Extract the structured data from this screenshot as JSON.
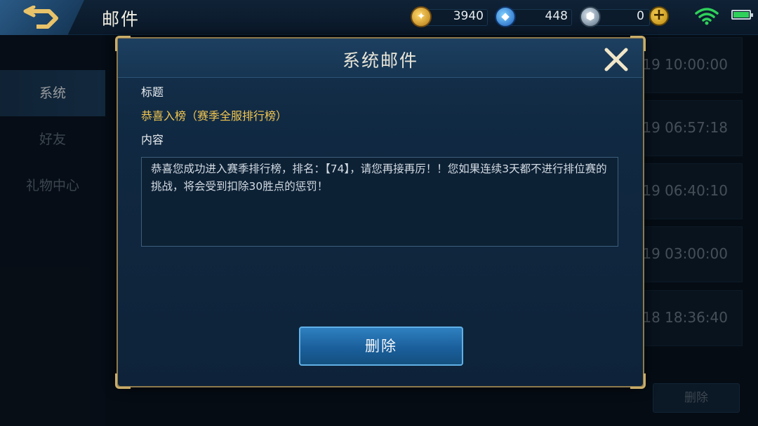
{
  "header": {
    "title": "邮件"
  },
  "currencies": [
    {
      "icon": "gold-coin-icon",
      "value": "3940"
    },
    {
      "icon": "diamond-icon",
      "value": "448"
    },
    {
      "icon": "voucher-icon",
      "value": "0"
    }
  ],
  "nav": {
    "items": [
      {
        "label": "系统"
      },
      {
        "label": "好友"
      },
      {
        "label": "礼物中心"
      }
    ]
  },
  "mail_list": {
    "times": [
      "-19 10:00:00",
      "-19 06:57:18",
      "-19 06:40:10",
      "-19 03:00:00",
      "-18 18:36:40"
    ],
    "delete_label": "删除"
  },
  "modal": {
    "title": "系统邮件",
    "subject_label": "标题",
    "subject": "恭喜入榜（赛季全服排行榜）",
    "content_label": "内容",
    "content": "恭喜您成功进入赛季排行榜，排名：【74】，请您再接再厉！！您如果连续3天都不进行排位赛的挑战，将会受到扣除30胜点的惩罚！",
    "delete_label": "删除"
  },
  "status": {
    "battery_level": 0.9,
    "accent_color": "#f0c550",
    "wifi_color": "#2fd15a"
  }
}
